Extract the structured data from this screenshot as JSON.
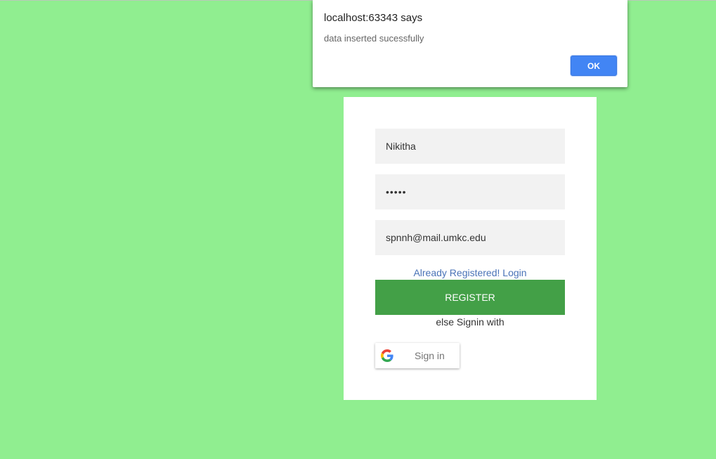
{
  "dialog": {
    "title": "localhost:63343 says",
    "message": "data inserted sucessfully",
    "ok_label": "OK"
  },
  "form": {
    "name_value": "Nikitha",
    "password_value": "12345",
    "email_value": "spnnh@mail.umkc.edu",
    "login_link": "Already Registered! Login",
    "register_label": "REGISTER",
    "else_text": "else Signin with",
    "google_signin_label": "Sign in"
  },
  "colors": {
    "background": "#90ee90",
    "register_button": "#43a047",
    "ok_button": "#4285f4",
    "link": "#4a73b7"
  },
  "icons": {
    "google": "google-logo-icon"
  }
}
